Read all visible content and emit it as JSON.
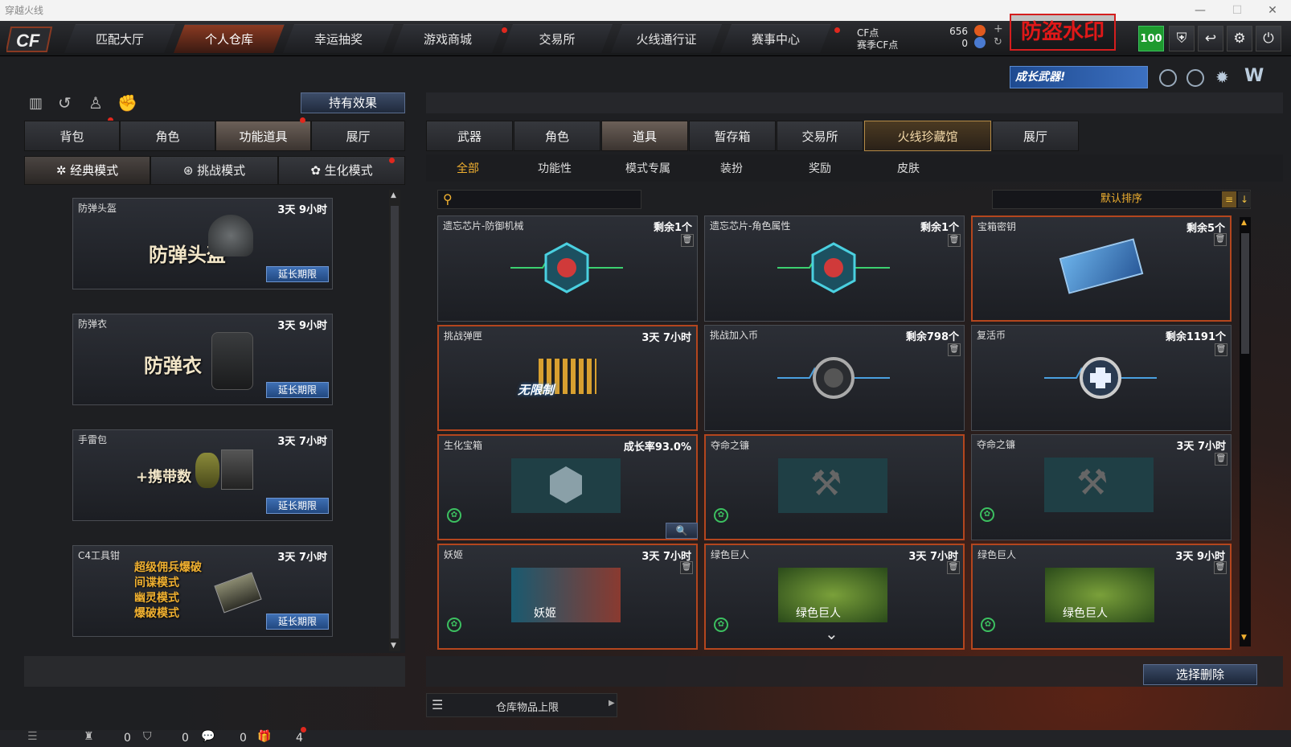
{
  "window": {
    "title": "穿越火线",
    "minimize": "—",
    "maximize": "☐",
    "close": "✕"
  },
  "nav": {
    "tabs": [
      "匹配大厅",
      "个人仓库",
      "幸运抽奖",
      "游戏商城",
      "交易所",
      "火线通行证",
      "赛事中心"
    ],
    "active": 1,
    "cf_label": "CF点",
    "season_label": "赛季CF点",
    "cf_value": "656",
    "season_value": "0",
    "level": "100",
    "watermark": "防盗水印",
    "banner": "成长武器!"
  },
  "left": {
    "effect_button": "持有效果",
    "tabs": [
      "背包",
      "角色",
      "功能道具",
      "展厅"
    ],
    "active_tab": 2,
    "modes": [
      "经典模式",
      "挑战模式",
      "生化模式"
    ],
    "items": [
      {
        "name": "防弹头盔",
        "time": "3天 9小时",
        "art": "防弹头盔",
        "button": "延长期限"
      },
      {
        "name": "防弹衣",
        "time": "3天 9小时",
        "art": "防弹衣",
        "button": "延长期限"
      },
      {
        "name": "手雷包",
        "time": "3天 7小时",
        "art": "+携带数",
        "button": "延长期限"
      },
      {
        "name": "C4工具钳",
        "time": "3天 7小时",
        "art_lines": [
          "超级佣兵爆破",
          "间谍模式",
          "幽灵模式",
          "爆破模式"
        ],
        "button": "延长期限"
      }
    ]
  },
  "right": {
    "tabs": [
      "武器",
      "角色",
      "道具",
      "暂存箱",
      "交易所",
      "火线珍藏馆",
      "展厅"
    ],
    "active_tab": 5,
    "subtabs": [
      "全部",
      "功能性",
      "模式专属",
      "装扮",
      "奖励",
      "皮肤"
    ],
    "active_subtab": 0,
    "search_placeholder": "",
    "sort": "默认排序",
    "cards": [
      {
        "name": "遗忘芯片-防御机械",
        "info": "剩余1个"
      },
      {
        "name": "遗忘芯片-角色属性",
        "info": "剩余1个"
      },
      {
        "name": "宝箱密钥",
        "info": "剩余5个"
      },
      {
        "name": "挑战弹匣",
        "info": "3天 7小时",
        "art": "无限制"
      },
      {
        "name": "挑战加入币",
        "info": "剩余798个"
      },
      {
        "name": "复活币",
        "info": "剩余1191个"
      },
      {
        "name": "生化宝箱",
        "info": "成长率93.0%"
      },
      {
        "name": "夺命之镰",
        "info": ""
      },
      {
        "name": "夺命之镰",
        "info": "3天 7小时"
      },
      {
        "name": "妖姬",
        "info": "3天 7小时",
        "art": "妖姬"
      },
      {
        "name": "绿色巨人",
        "info": "3天 7小时",
        "art": "绿色巨人"
      },
      {
        "name": "绿色巨人",
        "info": "3天 9小时",
        "art": "绿色巨人"
      }
    ],
    "delete_button": "选择删除",
    "capacity": "仓库物品上限"
  },
  "bottom": {
    "counts": [
      "0",
      "0",
      "0",
      "4"
    ]
  }
}
